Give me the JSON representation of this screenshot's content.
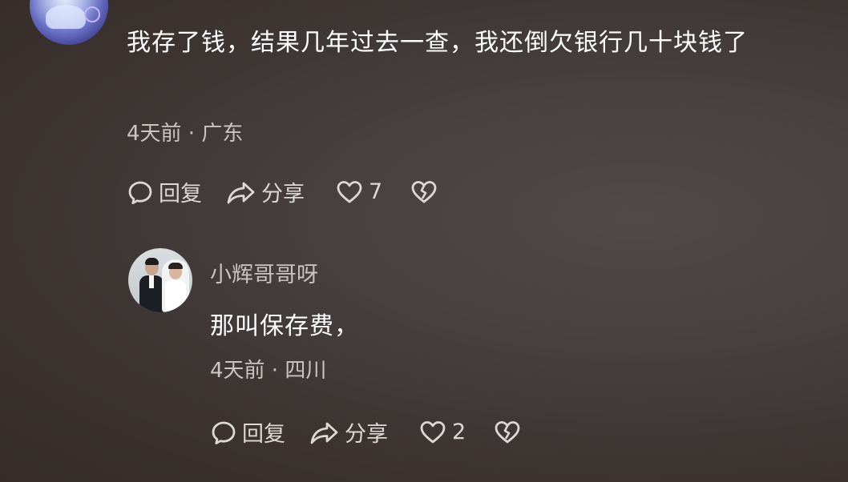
{
  "comment": {
    "text": "我存了钱，结果几年过去一查，我还倒欠银行几十块钱了",
    "meta": "4天前 · 广东",
    "actions": {
      "reply_label": "回复",
      "share_label": "分享",
      "like_count": "7"
    }
  },
  "reply": {
    "username": "小辉哥哥呀",
    "text": "那叫保存费，",
    "meta": "4天前 · 四川",
    "actions": {
      "reply_label": "回复",
      "share_label": "分享",
      "like_count": "2"
    }
  },
  "icons": {
    "reply": "speech-bubble-icon",
    "share": "share-arrow-icon",
    "like": "heart-icon",
    "dislike": "broken-heart-icon"
  },
  "colors": {
    "background": "#3e3634",
    "text": "#ffffff",
    "secondary": "#c9c5c3"
  }
}
